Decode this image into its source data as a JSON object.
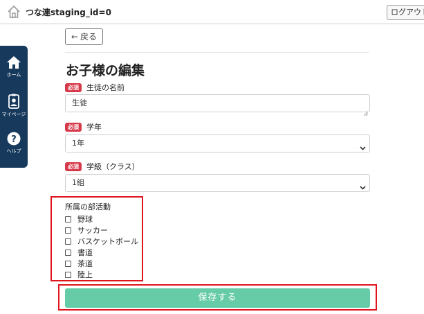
{
  "header": {
    "title": "つな連staging_id=0",
    "logout_label": "ログアウト"
  },
  "sidebar": {
    "items": [
      {
        "label": "ホーム",
        "icon": "home-icon"
      },
      {
        "label": "マイページ",
        "icon": "id-badge-icon"
      },
      {
        "label": "ヘルプ",
        "icon": "help-icon"
      }
    ]
  },
  "main": {
    "back_label": "戻る",
    "page_title": "お子様の編集",
    "required_badge": "必須",
    "student_name": {
      "label": "生徒の名前",
      "value": "生徒"
    },
    "grade": {
      "label": "学年",
      "value": "1年"
    },
    "class": {
      "label": "学級（クラス）",
      "value": "1組"
    },
    "clubs": {
      "label": "所属の部活動",
      "options": [
        {
          "label": "野球",
          "checked": false
        },
        {
          "label": "サッカー",
          "checked": false
        },
        {
          "label": "バスケットボール",
          "checked": false
        },
        {
          "label": "書道",
          "checked": false
        },
        {
          "label": "茶道",
          "checked": false
        },
        {
          "label": "陸上",
          "checked": false
        }
      ]
    },
    "save_label": "保存する"
  },
  "colors": {
    "nav_bg": "#173a5c",
    "required_badge": "#d63a4a",
    "save_button": "#66cba7",
    "highlight_box": "#e0141e"
  }
}
